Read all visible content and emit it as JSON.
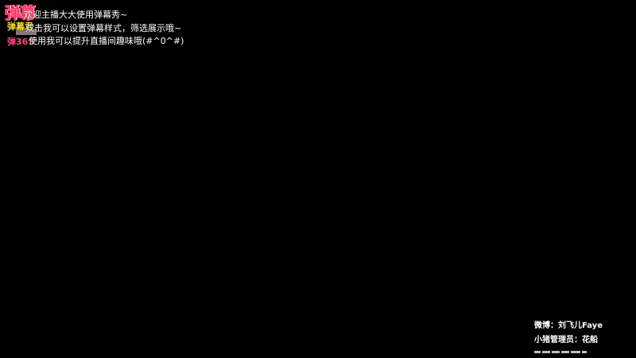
{
  "overlay": {
    "logo_mark": "弹幕",
    "logo_name": "弹幕君",
    "logo_sub": "弹365"
  },
  "danmaku": [
    "欢迎主播大大使用弹幕秀~",
    "双击我可以设置弹幕样式，筛选展示哦~",
    "使用我可以提升直播间趣味哦(#^0^#)"
  ],
  "credits": {
    "weibo": "微博：刘飞儿Faye",
    "admin": "小猪管理员：花船"
  },
  "colors": {
    "background": "#000000",
    "logo_red": "#ff3b6b",
    "logo_yellow": "#f5e52a",
    "text": "#ffffff"
  }
}
